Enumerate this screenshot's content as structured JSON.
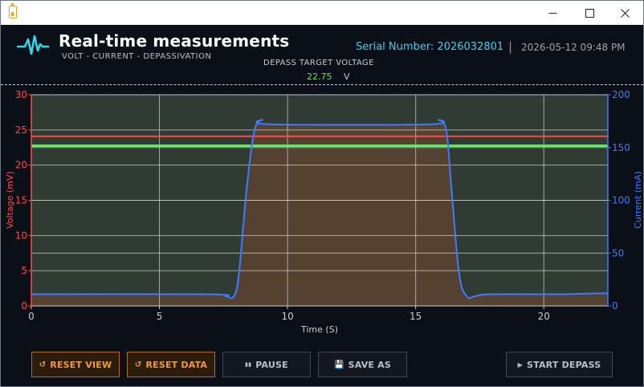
{
  "header": {
    "title": "Real-time measurements",
    "subtitle": "VOLT - CURRENT - DEPASSIVATION",
    "serial": "Serial Number: 2026032801",
    "separator": "|",
    "datetime": "2026-05-12  09:48 PM",
    "target_label": "DEPASS TARGET VOLTAGE",
    "target_value": "22.75",
    "target_unit": "V"
  },
  "icons": {
    "app": "battery-icon",
    "logo": "pulse-wave-icon",
    "minimize": "minimize-icon",
    "maximize": "maximize-icon",
    "close": "close-icon"
  },
  "buttons": {
    "reset_view": "RESET VIEW",
    "reset_data": "RESET DATA",
    "pause": "PAUSE",
    "save_as": "SAVE AS",
    "start_depass": "START DEPASS"
  },
  "button_icons": {
    "reset_view": "↺",
    "reset_data": "↺",
    "pause": "▮▮",
    "save_as": "💾",
    "start_depass": "▶"
  },
  "colors": {
    "voltage": "#ff4a4a",
    "current": "#3f7bff",
    "target_line": "#6ee06e",
    "accent_orange": "#f29a3a",
    "serial_cyan": "#3fd0e8"
  },
  "chart_data": {
    "type": "line",
    "xlabel": "Time (S)",
    "ylabel_left": "Voltage (mV)",
    "ylabel_right": "Current (mA)",
    "xlim": [
      0,
      22.5
    ],
    "ylim_left": [
      0,
      30
    ],
    "ylim_right": [
      0,
      200
    ],
    "x_ticks": [
      0,
      5,
      10,
      15,
      20
    ],
    "y_left_ticks": [
      0,
      5,
      10,
      15,
      20,
      25,
      30
    ],
    "y_right_ticks": [
      0,
      50,
      100,
      150,
      200
    ],
    "grid": true,
    "reference_lines": [
      {
        "y": 24.1,
        "axis": "left",
        "color": "#ff4a4a"
      },
      {
        "y": 22.75,
        "axis": "left",
        "color": "#6ee06e"
      }
    ],
    "series": [
      {
        "axis": "right",
        "color": "#3f7bff",
        "x": [
          0,
          6.9,
          7.6,
          7.9,
          8.1,
          8.4,
          8.7,
          9.0,
          9.4,
          15.5,
          15.9,
          16.2,
          16.4,
          16.7,
          17.0,
          17.3,
          17.9,
          20.5,
          21.5,
          22.5
        ],
        "y": [
          11,
          11,
          9,
          9,
          30,
          110,
          165,
          176,
          172,
          172,
          176,
          165,
          110,
          30,
          9,
          9,
          11,
          11,
          11.5,
          12
        ]
      }
    ]
  }
}
